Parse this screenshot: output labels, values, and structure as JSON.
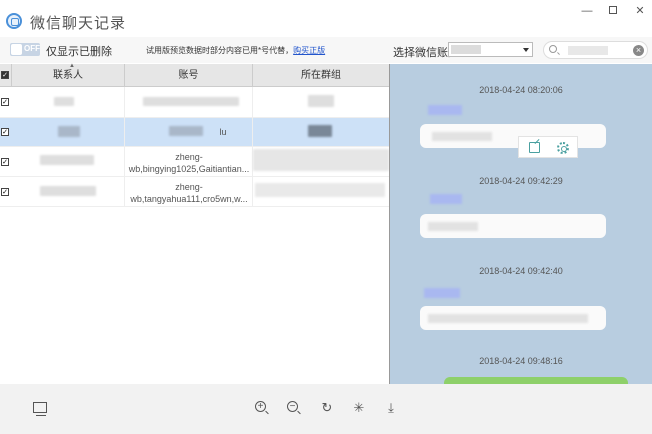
{
  "window": {
    "title": "微信聊天记录",
    "minimize_glyph": "—",
    "close_glyph": "✕"
  },
  "toolbar": {
    "toggle_state": "OFF",
    "only_deleted_label": "仅显示已删除",
    "trial_notice": "试用版预览数据时部分内容已用*号代替，",
    "buy_link": "购买正版",
    "account_label": "选择微信账户",
    "search_clear_glyph": "×"
  },
  "table": {
    "headers": {
      "contact": "联系人",
      "account": "账号",
      "group": "所在群组"
    },
    "rows": [
      {
        "checked": true,
        "account_line1": "",
        "account_line2": ""
      },
      {
        "checked": true,
        "account_line1": "lu",
        "account_line2": ""
      },
      {
        "checked": true,
        "account_line1": "zheng-",
        "account_line2": "wb,bingying1025,Gaitiantian..."
      },
      {
        "checked": true,
        "account_line1": "zheng-",
        "account_line2": "wb,tangyahua111,cro5wn,w..."
      }
    ],
    "check_glyph": "✓"
  },
  "chat": {
    "timestamps": [
      "2018-04-24 08:20:06",
      "2018-04-24 09:42:29",
      "2018-04-24 09:42:40",
      "2018-04-24 09:48:16"
    ]
  },
  "bottom_toolbar": {
    "zoom_in_glyph": "+",
    "zoom_out_glyph": "−",
    "refresh_glyph": "↻",
    "wand_glyph": "✳",
    "download_glyph": "⤓"
  },
  "colors": {
    "chat_background": "#b8cde0",
    "selected_row": "#cde1f7",
    "sender_highlight": "#a9b8f0",
    "green_bubble": "#8ed06a",
    "link": "#2255cc"
  }
}
